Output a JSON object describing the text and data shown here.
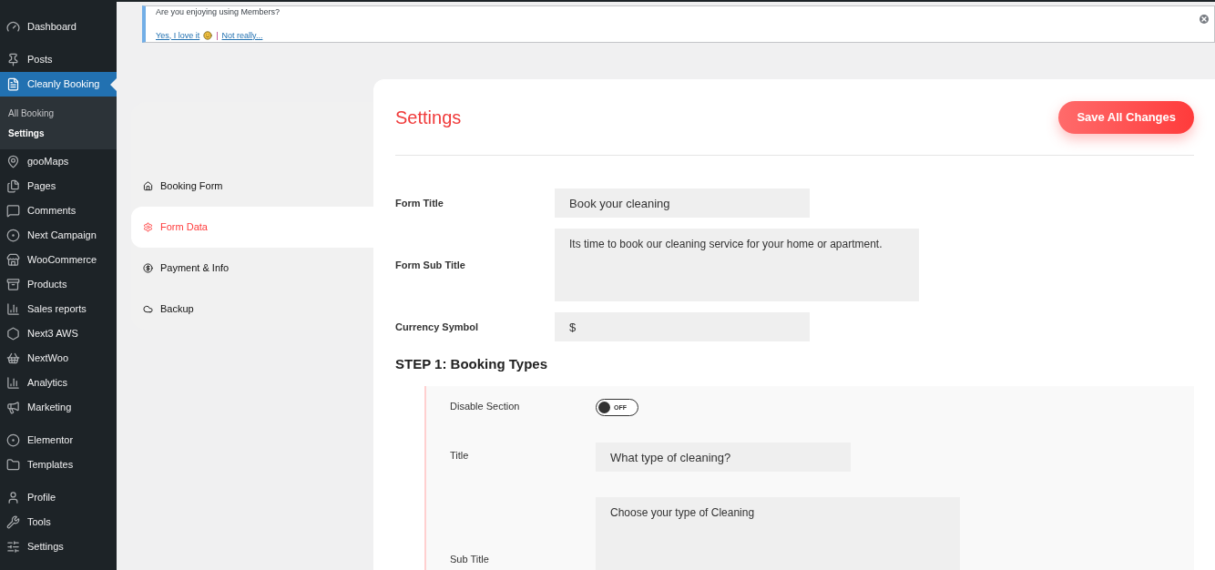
{
  "sidebar": {
    "groups": [
      {
        "items": [
          {
            "label": "Dashboard",
            "selected": false
          }
        ]
      },
      {
        "items": [
          {
            "label": "Posts",
            "selected": false
          },
          {
            "label": "Cleanly Booking",
            "selected": true,
            "children": [
              {
                "label": "All Booking",
                "selected": false
              },
              {
                "label": "Settings",
                "selected": true
              }
            ]
          },
          {
            "label": "gooMaps",
            "selected": false
          },
          {
            "label": "Pages",
            "selected": false
          },
          {
            "label": "Comments",
            "selected": false
          },
          {
            "label": "Next Campaign",
            "selected": false
          },
          {
            "label": "WooCommerce",
            "selected": false
          },
          {
            "label": "Products",
            "selected": false
          },
          {
            "label": "Sales reports",
            "selected": false
          },
          {
            "label": "Next3 AWS",
            "selected": false
          },
          {
            "label": "NextWoo",
            "selected": false
          },
          {
            "label": "Analytics",
            "selected": false
          },
          {
            "label": "Marketing",
            "selected": false
          }
        ]
      },
      {
        "items": [
          {
            "label": "Elementor",
            "selected": false
          },
          {
            "label": "Templates",
            "selected": false
          }
        ]
      },
      {
        "items": [
          {
            "label": "Profile",
            "selected": false
          },
          {
            "label": "Tools",
            "selected": false
          },
          {
            "label": "Settings",
            "selected": false
          }
        ]
      }
    ]
  },
  "notice": {
    "question": "Are you enjoying using Members?",
    "yes_link": "Yes, I love it",
    "separator": "|",
    "no_link": "Not really..."
  },
  "tabs": [
    {
      "label": "Booking Form",
      "selected": false
    },
    {
      "label": "Form Data",
      "selected": true
    },
    {
      "label": "Payment & Info",
      "selected": false
    },
    {
      "label": "Backup",
      "selected": false
    }
  ],
  "header": {
    "title": "Settings",
    "save_button": "Save All Changes"
  },
  "fields": [
    {
      "kind": "input",
      "label": "Form Title",
      "value": "Book your cleaning"
    },
    {
      "kind": "textarea",
      "label": "Form Sub Title",
      "value": "Its time to book our cleaning service for your home or apartment."
    },
    {
      "kind": "input",
      "label": "Currency Symbol",
      "value": "$"
    }
  ],
  "step": {
    "title": "STEP 1: Booking Types",
    "rows": [
      {
        "kind": "toggle",
        "label": "Disable Section",
        "on": false,
        "toggle_text": "OFF"
      },
      {
        "kind": "input",
        "label": "Title",
        "value": "What type of cleaning?"
      },
      {
        "kind": "textarea",
        "label": "Sub Title",
        "value": "Choose your type of Cleaning"
      }
    ]
  }
}
